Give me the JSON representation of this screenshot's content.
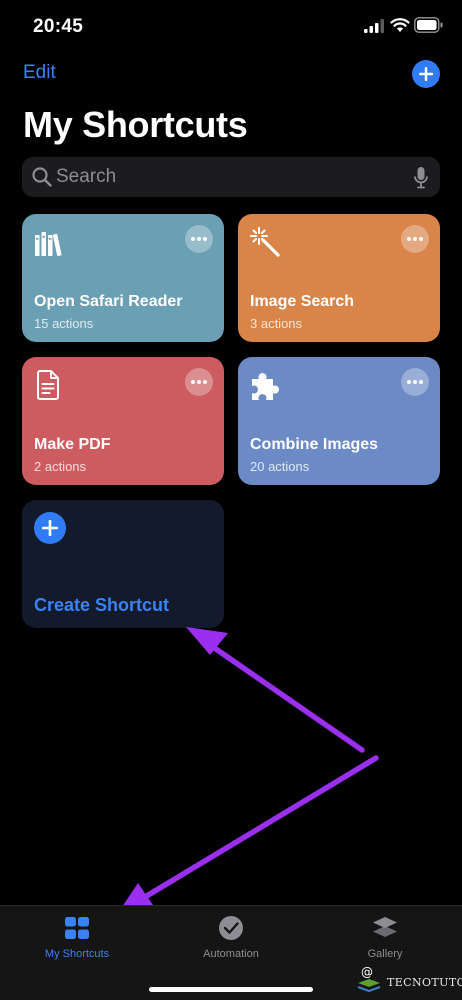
{
  "status_bar": {
    "time": "20:45"
  },
  "nav": {
    "edit_label": "Edit"
  },
  "page": {
    "title": "My Shortcuts"
  },
  "search": {
    "placeholder": "Search"
  },
  "shortcuts": [
    {
      "title": "Open Safari Reader",
      "subtitle": "15 actions",
      "color": "#6a9fb4",
      "icon": "library-icon"
    },
    {
      "title": "Image Search",
      "subtitle": "3 actions",
      "color": "#d98549",
      "icon": "magic-wand-icon"
    },
    {
      "title": "Make PDF",
      "subtitle": "2 actions",
      "color": "#cd5c60",
      "icon": "document-icon"
    },
    {
      "title": "Combine Images",
      "subtitle": "20 actions",
      "color": "#6c8bc6",
      "icon": "puzzle-icon"
    }
  ],
  "create_card": {
    "label": "Create Shortcut"
  },
  "tabs": [
    {
      "label": "My Shortcuts",
      "icon": "grid-icon",
      "active": true
    },
    {
      "label": "Automation",
      "icon": "clock-check-icon",
      "active": false
    },
    {
      "label": "Gallery",
      "icon": "layers-icon",
      "active": false
    }
  ],
  "watermark": {
    "text": "TECNOTUTO"
  },
  "colors": {
    "accent": "#2f7cf6",
    "annotation": "#9b2ff0",
    "background": "#000000"
  }
}
